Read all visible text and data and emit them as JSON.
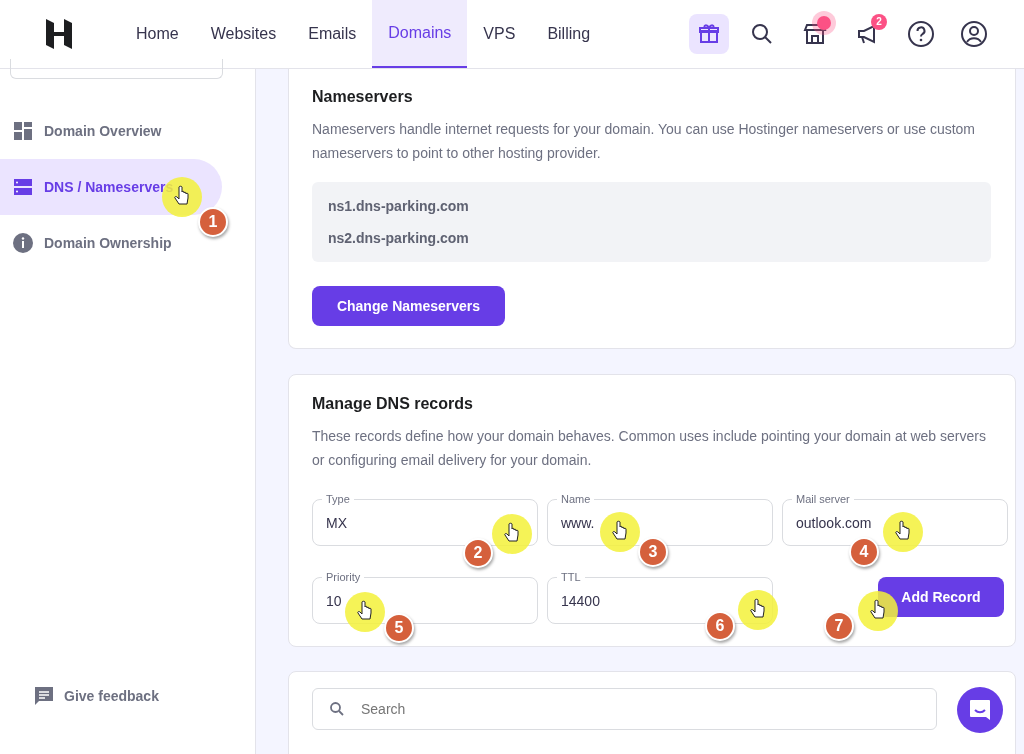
{
  "nav": {
    "items": [
      {
        "label": "Home",
        "selected": false
      },
      {
        "label": "Websites",
        "selected": false
      },
      {
        "label": "Emails",
        "selected": false
      },
      {
        "label": "Domains",
        "selected": true
      },
      {
        "label": "VPS",
        "selected": false
      },
      {
        "label": "Billing",
        "selected": false
      }
    ],
    "notification_count": "2"
  },
  "sidebar": {
    "items": [
      {
        "label": "Domain Overview",
        "kind": "overview",
        "selected": false
      },
      {
        "label": "DNS / Nameservers",
        "kind": "dns",
        "selected": true,
        "step": "1"
      },
      {
        "label": "Domain Ownership",
        "kind": "ownership",
        "selected": false
      }
    ],
    "feedback": "Give feedback"
  },
  "nameservers": {
    "title": "Nameservers",
    "description": "Nameservers handle internet requests for your domain. You can use Hostinger nameservers or use custom nameservers to point to other hosting provider.",
    "servers": [
      "ns1.dns-parking.com",
      "ns2.dns-parking.com"
    ],
    "button": "Change Nameservers"
  },
  "dns": {
    "title": "Manage DNS records",
    "description": "These records define how your domain behaves. Common uses include pointing your domain at web servers or configuring email delivery for your domain.",
    "fields": [
      {
        "label": "Type",
        "value": "MX",
        "step": "2"
      },
      {
        "label": "Name",
        "value": "www.",
        "step": "3"
      },
      {
        "label": "Mail server",
        "value": "outlook.com",
        "step": "4"
      },
      {
        "label": "Priority",
        "value": "10",
        "step": "5"
      },
      {
        "label": "TTL",
        "value": "14400",
        "step": "6"
      }
    ],
    "button": {
      "label": "Add Record",
      "step": "7"
    }
  },
  "search": {
    "placeholder": "Search"
  }
}
